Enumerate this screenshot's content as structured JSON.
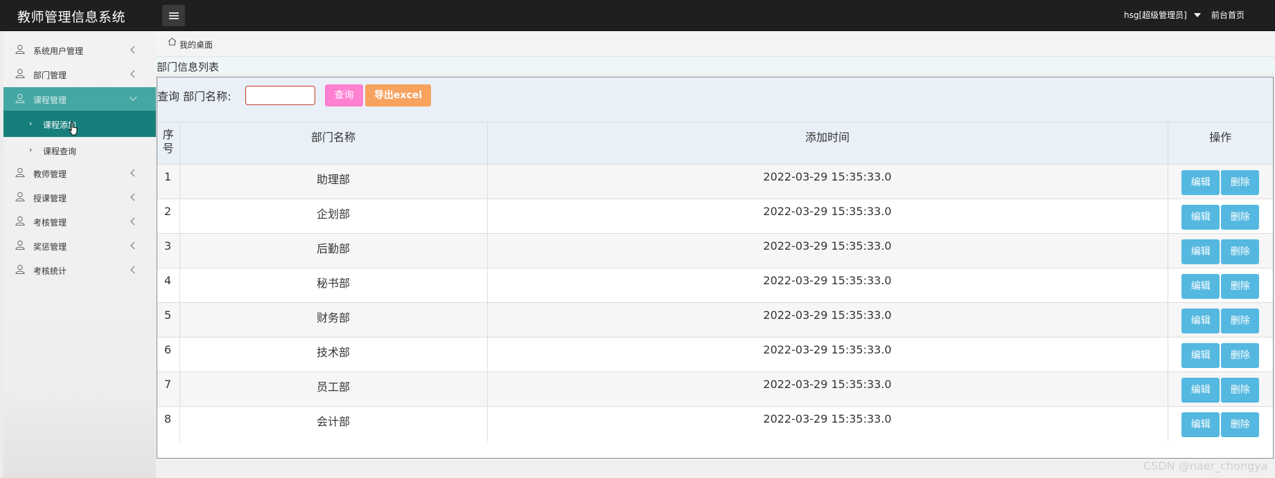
{
  "app": {
    "title": "教师管理信息系统"
  },
  "header": {
    "user": "hsg[超级管理员]",
    "front_link": "前台首页"
  },
  "sidebar": {
    "items": [
      {
        "label": "系统用户管理"
      },
      {
        "label": "部门管理"
      },
      {
        "label": "课程管理"
      },
      {
        "label": "教师管理"
      },
      {
        "label": "授课管理"
      },
      {
        "label": "考核管理"
      },
      {
        "label": "奖惩管理"
      },
      {
        "label": "考核统计"
      }
    ],
    "sub_items": [
      {
        "label": "课程添加"
      },
      {
        "label": "课程查询"
      }
    ]
  },
  "breadcrumb": {
    "label": "我的桌面"
  },
  "panel": {
    "title": "部门信息列表"
  },
  "search": {
    "label": "查询 部门名称:",
    "value": "",
    "query_button": "查询",
    "export_button": "导出excel"
  },
  "table": {
    "headers": {
      "index_line1": "序",
      "index_line2": "号",
      "name": "部门名称",
      "time": "添加时间",
      "ops": "操作"
    },
    "rows": [
      {
        "index": "1",
        "name": "助理部",
        "time": "2022-03-29 15:35:33.0"
      },
      {
        "index": "2",
        "name": "企划部",
        "time": "2022-03-29 15:35:33.0"
      },
      {
        "index": "3",
        "name": "后勤部",
        "time": "2022-03-29 15:35:33.0"
      },
      {
        "index": "4",
        "name": "秘书部",
        "time": "2022-03-29 15:35:33.0"
      },
      {
        "index": "5",
        "name": "财务部",
        "time": "2022-03-29 15:35:33.0"
      },
      {
        "index": "6",
        "name": "技术部",
        "time": "2022-03-29 15:35:33.0"
      },
      {
        "index": "7",
        "name": "员工部",
        "time": "2022-03-29 15:35:33.0"
      },
      {
        "index": "8",
        "name": "会计部",
        "time": "2022-03-29 15:35:33.0"
      }
    ],
    "edit_label": "编辑",
    "delete_label": "删除"
  },
  "watermark": "CSDN @naer_chongya",
  "colors": {
    "topbar": "#1f1f1f",
    "sidebar_active": "#45a7a3",
    "sidebar_sub_active": "#177f7b",
    "query_button": "#ff7fd1",
    "export_button": "#f7a25e",
    "op_button": "#55b8e0"
  }
}
